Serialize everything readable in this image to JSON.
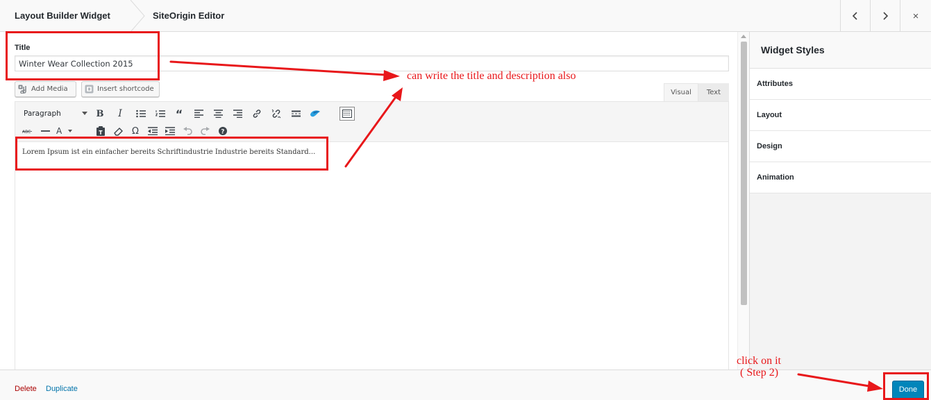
{
  "header": {
    "breadcrumb_1": "Layout Builder Widget",
    "breadcrumb_2": "SiteOrigin Editor",
    "prev_label": "‹",
    "next_label": "›",
    "close_label": "×"
  },
  "form": {
    "title_label": "Title",
    "title_value": "Winter Wear Collection 2015",
    "add_media_label": "Add Media",
    "insert_shortcode_label": "Insert shortcode",
    "tab_visual": "Visual",
    "tab_text": "Text",
    "format_select_value": "Paragraph",
    "content_text": "Lorem Ipsum ist ein einfacher bereits Schriftindustrie Industrie bereits Standard..."
  },
  "toolbar_row1": [
    "bold",
    "italic",
    "bulleted-list",
    "numbered-list",
    "blockquote",
    "align-left",
    "align-center",
    "align-right",
    "link",
    "unlink",
    "read-more",
    "siteorigin-logo",
    "toolbar-toggle"
  ],
  "toolbar_row2": [
    "strikethrough",
    "horizontal-line",
    "text-color",
    "paste-as-text",
    "clear-formatting",
    "special-character",
    "outdent",
    "indent",
    "undo",
    "redo",
    "help"
  ],
  "sidebar": {
    "title": "Widget Styles",
    "items": [
      {
        "label": "Attributes"
      },
      {
        "label": "Layout"
      },
      {
        "label": "Design"
      },
      {
        "label": "Animation"
      }
    ]
  },
  "footer": {
    "delete_label": "Delete",
    "duplicate_label": "Duplicate",
    "done_label": "Done"
  },
  "annotations": {
    "note_1": "can write the title and description also",
    "note_2_line1": "click on it",
    "note_2_line2": "( Step 2)",
    "annotation_color": "#e8171a"
  },
  "colors": {
    "primary_button": "#0085ba",
    "delete_link": "#aa0000",
    "duplicate_link": "#0073aa"
  }
}
